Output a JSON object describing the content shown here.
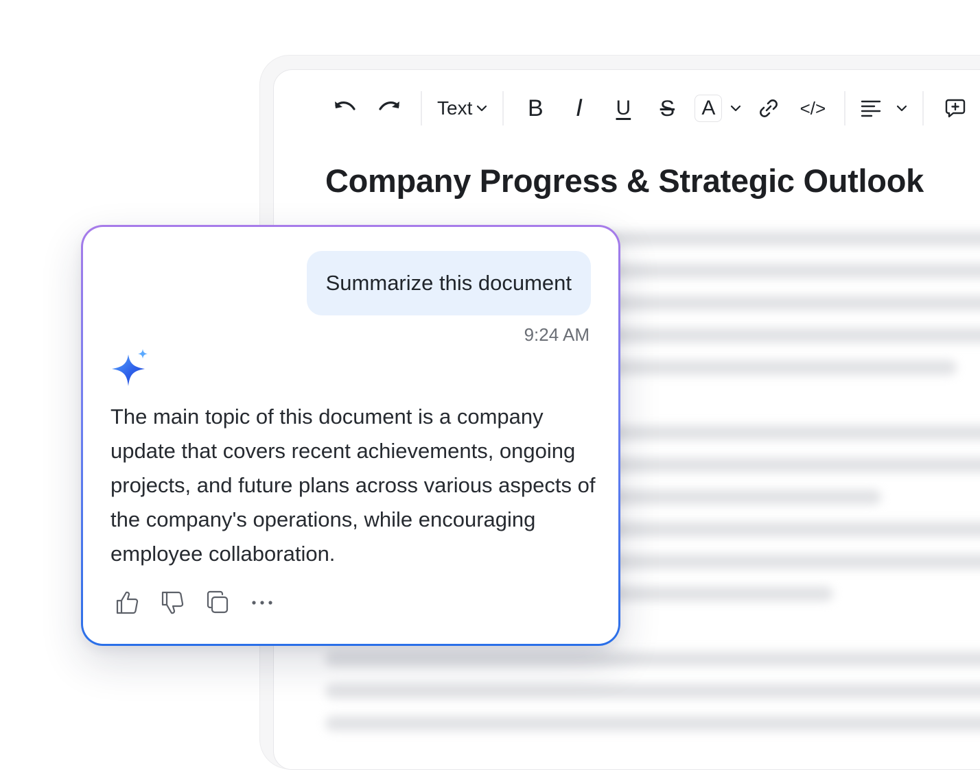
{
  "toolbar": {
    "undo_icon": "undo-icon",
    "redo_icon": "redo-icon",
    "text_style": "Text",
    "bold": "B",
    "italic": "I",
    "underline": "U",
    "strikethrough": "S",
    "font_color": "A",
    "link_icon": "link-icon",
    "code_icon": "code-icon",
    "code_glyph": "</>",
    "align_icon": "align-left-icon",
    "comment_icon": "comment-add-icon"
  },
  "document": {
    "title": "Company Progress & Strategic Outlook"
  },
  "chat": {
    "user_message": "Summarize this document",
    "timestamp": "9:24 AM",
    "assistant_icon": "sparkle-icon",
    "assistant_message": "The main topic of this document is a company update that covers recent achievements, ongoing projects, and future plans across various aspects of the company's operations, while encouraging employee collaboration.",
    "actions": [
      "thumbs-up-icon",
      "thumbs-down-icon",
      "copy-icon",
      "more-icon"
    ]
  },
  "colors": {
    "card_border_top": "#a77be9",
    "card_border_bottom": "#2a6fe8",
    "user_bubble": "#e8f1fd",
    "sparkle_dark": "#1f4fe0",
    "sparkle_light": "#5aa9ff"
  }
}
